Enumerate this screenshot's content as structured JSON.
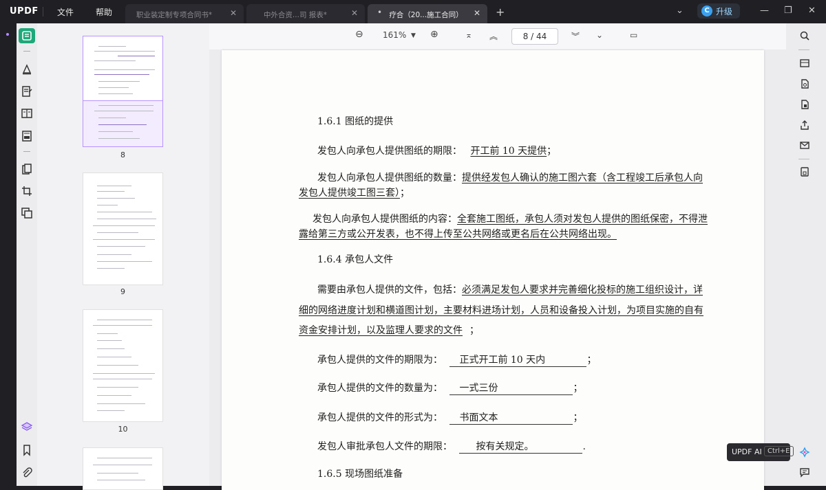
{
  "app": {
    "logo": "UPDF"
  },
  "menu": {
    "file": "文件",
    "help": "帮助"
  },
  "tabs": [
    {
      "label": "职业装定制专项合同书*",
      "state": "inactive"
    },
    {
      "label": "中外合资...司 报表*",
      "state": "inactive"
    },
    {
      "label": "疗合（20...施工合同）",
      "state": "active",
      "marker": "•"
    }
  ],
  "account": {
    "avatar_letter": "C",
    "upgrade_label": "升级"
  },
  "toolbar": {
    "zoom": "161%",
    "page_current": "8",
    "page_sep": "/",
    "page_total": "44"
  },
  "thumbnails": [
    {
      "label": "8",
      "selected": true
    },
    {
      "label": "9",
      "selected": false
    },
    {
      "label": "10",
      "selected": false
    },
    {
      "label": "",
      "selected": false
    }
  ],
  "document": {
    "heading_161": "1.6.1  图纸的提供",
    "p1_prefix": "发包人向承包人提供图纸的期限：",
    "p1_value": "开工前 10 天提供",
    "p1_end": "；",
    "p2_prefix": "发包人向承包人提供图纸的数量：",
    "p2_value_a": "提供经发包人确认的施工图六套（含工程竣工后承包人向",
    "p2_value_b": "发包人提供竣工图三套）",
    "p2_end": "；",
    "p3_prefix": "发包人向承包人提供图纸的内容：",
    "p3_value_a": "全套施工图纸，承包人须对发包人提供的图纸保密，不得泄",
    "p3_value_b": "露给第三方或公开发表，也不得上传至公共网络或更名后在公共网络出现。",
    "heading_164": "1.6.4  承包人文件",
    "p4_prefix": "需要由承包人提供的文件，包括：",
    "p4_value_a": "必须满足发包人要求并完善细化投标的施工组织设计，详",
    "p4_value_b": "细的网络进度计划和横道图计划，主要材料进场计划，人员和设备投入计划，为项目实施的自有",
    "p4_value_c": "资金安排计划，以及监理人要求的文件",
    "p4_end": "；",
    "p5_prefix": "承包人提供的文件的期限为：",
    "p5_value": "正式开工前 10 天内",
    "p5_end": "；",
    "p6_prefix": "承包人提供的文件的数量为：",
    "p6_value": "一式三份",
    "p6_end": "；",
    "p7_prefix": "承包人提供的文件的形式为：",
    "p7_value": "书面文本",
    "p7_end": "；",
    "p8_prefix": "发包人审批承包人文件的期限：",
    "p8_value": "按有关规定。",
    "p8_end": ".",
    "heading_165": "1.6.5  现场图纸准备"
  },
  "ai_tooltip": {
    "label": "UPDF AI",
    "shortcut": "Ctrl+E"
  },
  "colors": {
    "accent_green": "#1fa97a",
    "accent_purple": "#b892ff",
    "titlebar": "#1f1f24"
  }
}
